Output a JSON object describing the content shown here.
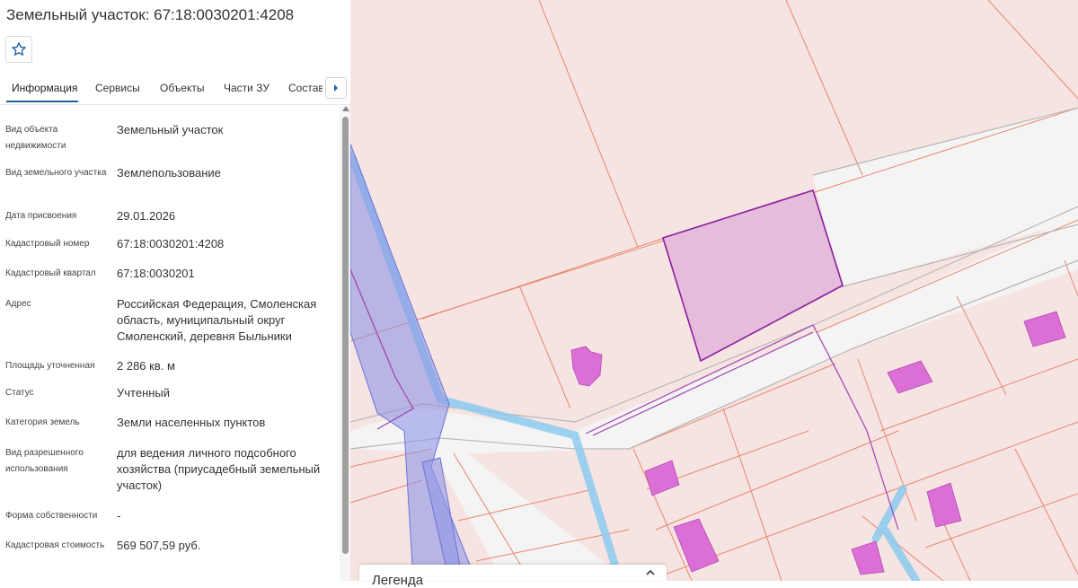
{
  "header": {
    "title": "Земельный участок: 67:18:0030201:4208"
  },
  "toolbar": {
    "favorite_icon": "star-icon"
  },
  "tabs": [
    {
      "label": "Информация",
      "active": true
    },
    {
      "label": "Сервисы"
    },
    {
      "label": "Объекты"
    },
    {
      "label": "Части ЗУ"
    },
    {
      "label": "Состав"
    }
  ],
  "info": [
    {
      "label": "Вид объекта недвижимости",
      "value": "Земельный участок"
    },
    {
      "label": "Вид земельного участка",
      "value": "Землепользование"
    },
    {
      "label": "Дата присвоения",
      "value": "29.01.2026"
    },
    {
      "label": "Кадастровый номер",
      "value": "67:18:0030201:4208"
    },
    {
      "label": "Кадастровый квартал",
      "value": "67:18:0030201"
    },
    {
      "label": "Адрес",
      "value": "Российская Федерация, Смоленская область, муниципальный округ Смоленский, деревня Быльники"
    },
    {
      "label": "Площадь уточненная",
      "value": "2 286 кв. м"
    },
    {
      "label": "Статус",
      "value": "Учтенный"
    },
    {
      "label": "Категория земель",
      "value": "Земли населенных пунктов"
    },
    {
      "label": "Вид разрешенного использования",
      "value": "для ведения личного подсобного хозяйства (приусадебный земельный участок)"
    },
    {
      "label": "Форма собственности",
      "value": "-"
    },
    {
      "label": "Кадастровая стоимость",
      "value": "569 507,59 руб."
    }
  ],
  "legend": {
    "title": "Легенда"
  },
  "colors": {
    "accent": "#1f5e9e",
    "selected_parcel": "#e6bcdc",
    "building": "#dc6fd6",
    "parcel_fill": "#f6e4e2",
    "parcel_border": "#e8866e",
    "water": "#8ccbef"
  }
}
